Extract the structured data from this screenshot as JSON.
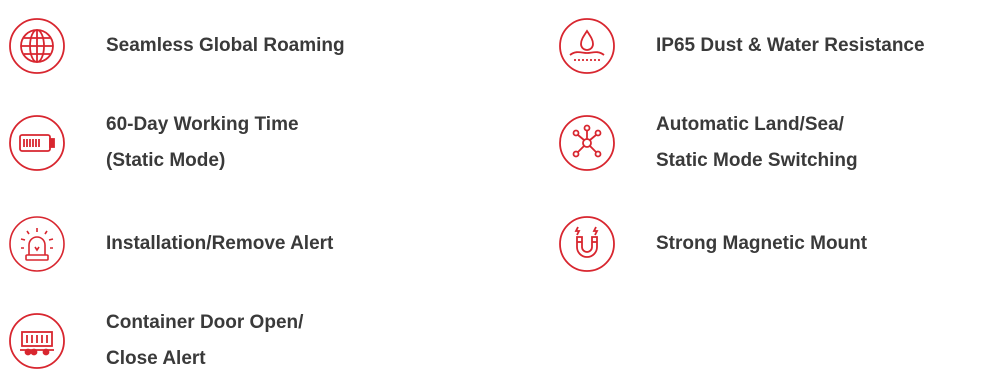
{
  "accent_color": "#d8262f",
  "text_color": "#3a3a3a",
  "features_left": [
    {
      "icon": "globe-icon",
      "lines": [
        "Seamless Global Roaming"
      ]
    },
    {
      "icon": "battery-icon",
      "lines": [
        "60-Day Working Time",
        "(Static Mode)"
      ]
    },
    {
      "icon": "alarm-siren-icon",
      "lines": [
        "Installation/Remove Alert"
      ]
    },
    {
      "icon": "container-icon",
      "lines": [
        "Container Door Open/",
        "Close Alert"
      ]
    }
  ],
  "features_right": [
    {
      "icon": "water-drop-icon",
      "lines": [
        "IP65 Dust & Water Resistance"
      ]
    },
    {
      "icon": "network-hub-icon",
      "lines": [
        "Automatic Land/Sea/",
        "Static Mode Switching"
      ]
    },
    {
      "icon": "magnet-icon",
      "lines": [
        "Strong Magnetic Mount"
      ]
    }
  ]
}
